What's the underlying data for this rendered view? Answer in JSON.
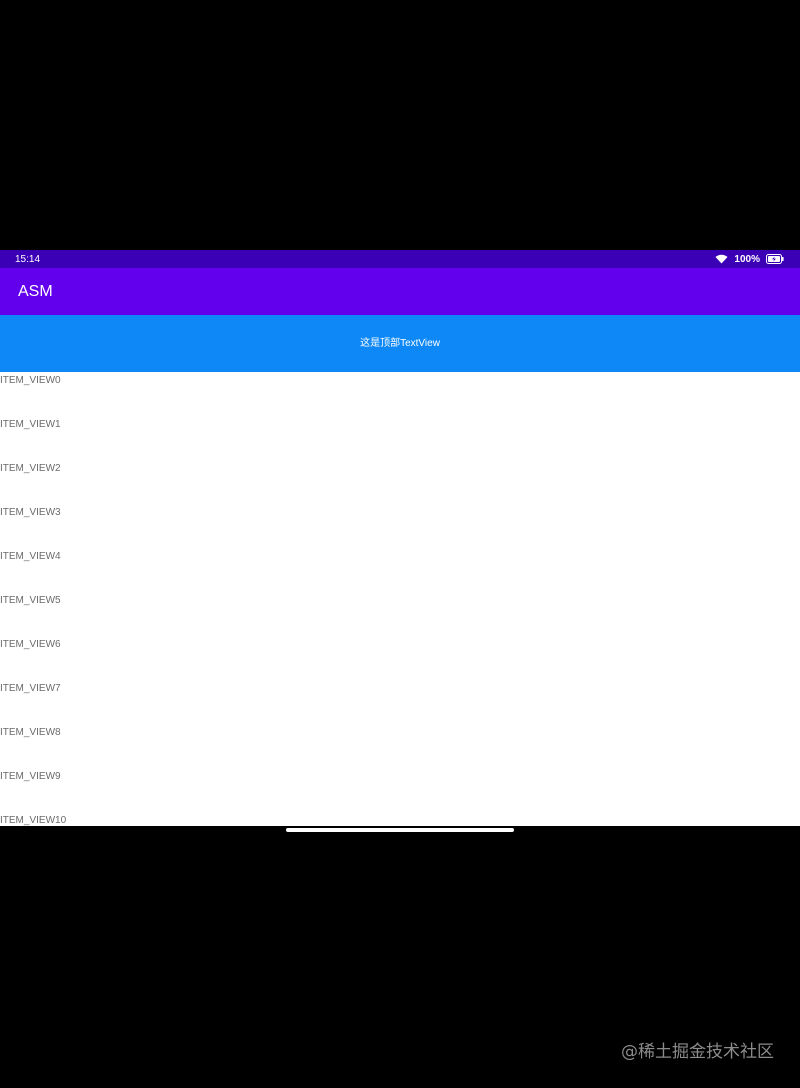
{
  "status_bar": {
    "time": "15:14",
    "battery_percent": "100%",
    "icons": [
      "wifi-icon",
      "battery-charging-icon"
    ]
  },
  "app_bar": {
    "title": "ASM"
  },
  "top_textview": {
    "text": "这是顶部TextView"
  },
  "items": [
    "ITEM_VIEW0",
    "ITEM_VIEW1",
    "ITEM_VIEW2",
    "ITEM_VIEW3",
    "ITEM_VIEW4",
    "ITEM_VIEW5",
    "ITEM_VIEW6",
    "ITEM_VIEW7",
    "ITEM_VIEW8",
    "ITEM_VIEW9",
    "ITEM_VIEW10"
  ],
  "watermark": "@稀土掘金技术社区",
  "colors": {
    "status_bar": "#3b00b6",
    "app_bar": "#6200ee",
    "top_textview": "#0e88f6",
    "item_text": "#6b6b6b",
    "background": "#000000"
  }
}
